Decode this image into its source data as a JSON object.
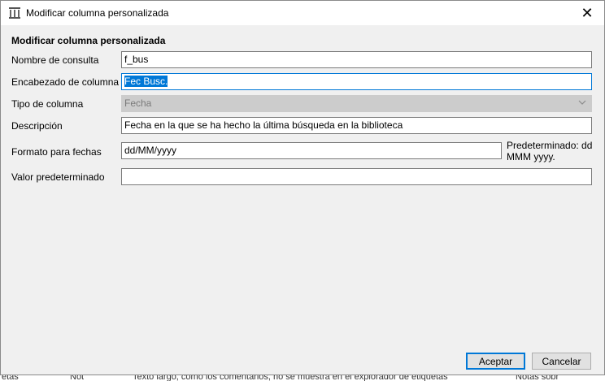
{
  "window": {
    "title": "Modificar columna personalizada",
    "close_glyph": "✕"
  },
  "form": {
    "section_title": "Modificar columna personalizada",
    "lookup_name": {
      "label": "Nombre de consulta",
      "value": "f_bus"
    },
    "column_heading": {
      "label": "Encabezado de columna",
      "value": "Fec Busc."
    },
    "column_type": {
      "label": "Tipo de columna",
      "value": "Fecha"
    },
    "description": {
      "label": "Descripción",
      "value": "Fecha en la que se ha hecho la última búsqueda en la biblioteca"
    },
    "date_format": {
      "label": "Formato para fechas",
      "value": "dd/MM/yyyy",
      "hint_line1": "Predeterminado: dd",
      "hint_line2": "MMM yyyy."
    },
    "default_value": {
      "label": "Valor predeterminado",
      "value": ""
    }
  },
  "buttons": {
    "accept": "Aceptar",
    "cancel": "Cancelar"
  },
  "background": {
    "cells": [
      "etas",
      "Not",
      "Texto largo, como los comentarios, no se muestra en el explorador de etiquetas",
      "Notas sobr"
    ]
  },
  "colors": {
    "accent": "#0078d7",
    "dialog_bg": "#f0f0f0",
    "disabled_field": "#cccccc"
  },
  "icons": {
    "app": "library-icon",
    "chevron": "chevron-down-icon",
    "close": "close-icon"
  }
}
